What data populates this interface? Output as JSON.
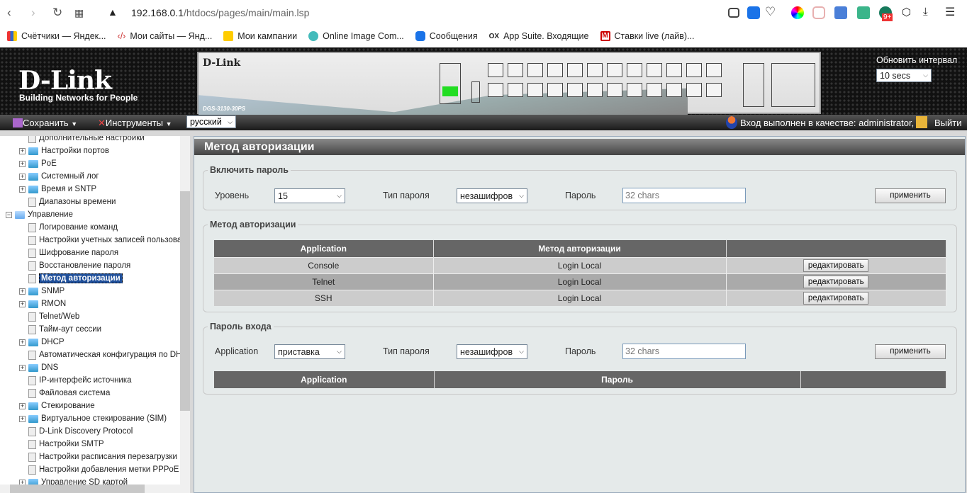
{
  "browser": {
    "url_host": "192.168.0.1",
    "url_path": "/htdocs/pages/main/main.lsp",
    "bookmarks": [
      "Счётчики — Яндек...",
      "Мои сайты — Янд...",
      "Мои кампании",
      "Online Image Com...",
      "Сообщения",
      "App Suite. Входящие",
      "Ставки live (лайв)..."
    ],
    "badge": "9+"
  },
  "header": {
    "logo": "D-Link",
    "tagline": "Building Networks for People",
    "model": "DGS-3130-30PS",
    "refresh_label": "Обновить интервал",
    "refresh_value": "10 secs"
  },
  "menu": {
    "save": "Сохранить",
    "tools": "Инструменты",
    "language": "русский",
    "logged_in": "Вход выполнен в качестве: administrator, ...",
    "logout": "Выйти"
  },
  "tree": [
    {
      "label": "Дополнительные настройки",
      "type": "doc",
      "level": 1
    },
    {
      "label": "Настройки портов",
      "type": "folder",
      "level": 1
    },
    {
      "label": "PoE",
      "type": "folder",
      "level": 1
    },
    {
      "label": "Системный лог",
      "type": "folder",
      "level": 1
    },
    {
      "label": "Время и SNTP",
      "type": "folder",
      "level": 1
    },
    {
      "label": "Диапазоны времени",
      "type": "doc",
      "level": 1
    },
    {
      "label": "Управление",
      "type": "open",
      "level": 0
    },
    {
      "label": "Логирование команд",
      "type": "doc",
      "level": 1
    },
    {
      "label": "Настройки учетных записей пользоват",
      "type": "doc",
      "level": 1
    },
    {
      "label": "Шифрование пароля",
      "type": "doc",
      "level": 1
    },
    {
      "label": "Восстановление пароля",
      "type": "doc",
      "level": 1
    },
    {
      "label": "Метод авторизации",
      "type": "doc",
      "level": 1,
      "selected": true
    },
    {
      "label": "SNMP",
      "type": "folder",
      "level": 1
    },
    {
      "label": "RMON",
      "type": "folder",
      "level": 1
    },
    {
      "label": "Telnet/Web",
      "type": "doc",
      "level": 1
    },
    {
      "label": "Тайм-аут сессии",
      "type": "doc",
      "level": 1
    },
    {
      "label": "DHCP",
      "type": "folder",
      "level": 1
    },
    {
      "label": "Автоматическая конфигурация по DHC",
      "type": "doc",
      "level": 1
    },
    {
      "label": "DNS",
      "type": "folder",
      "level": 1
    },
    {
      "label": "IP-интерфейс источника",
      "type": "doc",
      "level": 1
    },
    {
      "label": "Файловая система",
      "type": "doc",
      "level": 1
    },
    {
      "label": "Стекирование",
      "type": "folder",
      "level": 1
    },
    {
      "label": "Виртуальное стекирование (SIM)",
      "type": "folder",
      "level": 1
    },
    {
      "label": "D-Link Discovery Protocol",
      "type": "doc",
      "level": 1
    },
    {
      "label": "Настройки SMTP",
      "type": "doc",
      "level": 1
    },
    {
      "label": "Настройки расписания перезагрузки",
      "type": "doc",
      "level": 1
    },
    {
      "label": "Настройки добавления метки PPPoE C",
      "type": "doc",
      "level": 1
    },
    {
      "label": "Управление SD картой",
      "type": "folder",
      "level": 1
    }
  ],
  "main": {
    "title": "Метод авторизации",
    "enable": {
      "legend": "Включить пароль",
      "level_label": "Уровень",
      "level_value": "15",
      "type_label": "Тип пароля",
      "type_value": "незашифров",
      "pw_label": "Пароль",
      "pw_placeholder": "32 chars",
      "apply": "применить"
    },
    "auth": {
      "legend": "Метод авторизации",
      "headers": [
        "Application",
        "Метод авторизации",
        ""
      ],
      "rows": [
        {
          "app": "Console",
          "method": "Login Local",
          "action": "редактировать"
        },
        {
          "app": "Telnet",
          "method": "Login Local",
          "action": "редактировать"
        },
        {
          "app": "SSH",
          "method": "Login Local",
          "action": "редактировать"
        }
      ]
    },
    "login": {
      "legend": "Пароль входа",
      "app_label": "Application",
      "app_value": "приставка",
      "type_label": "Тип пароля",
      "type_value": "незашифров",
      "pw_label": "Пароль",
      "pw_placeholder": "32 chars",
      "apply": "применить",
      "headers": [
        "Application",
        "Пароль",
        ""
      ]
    }
  }
}
